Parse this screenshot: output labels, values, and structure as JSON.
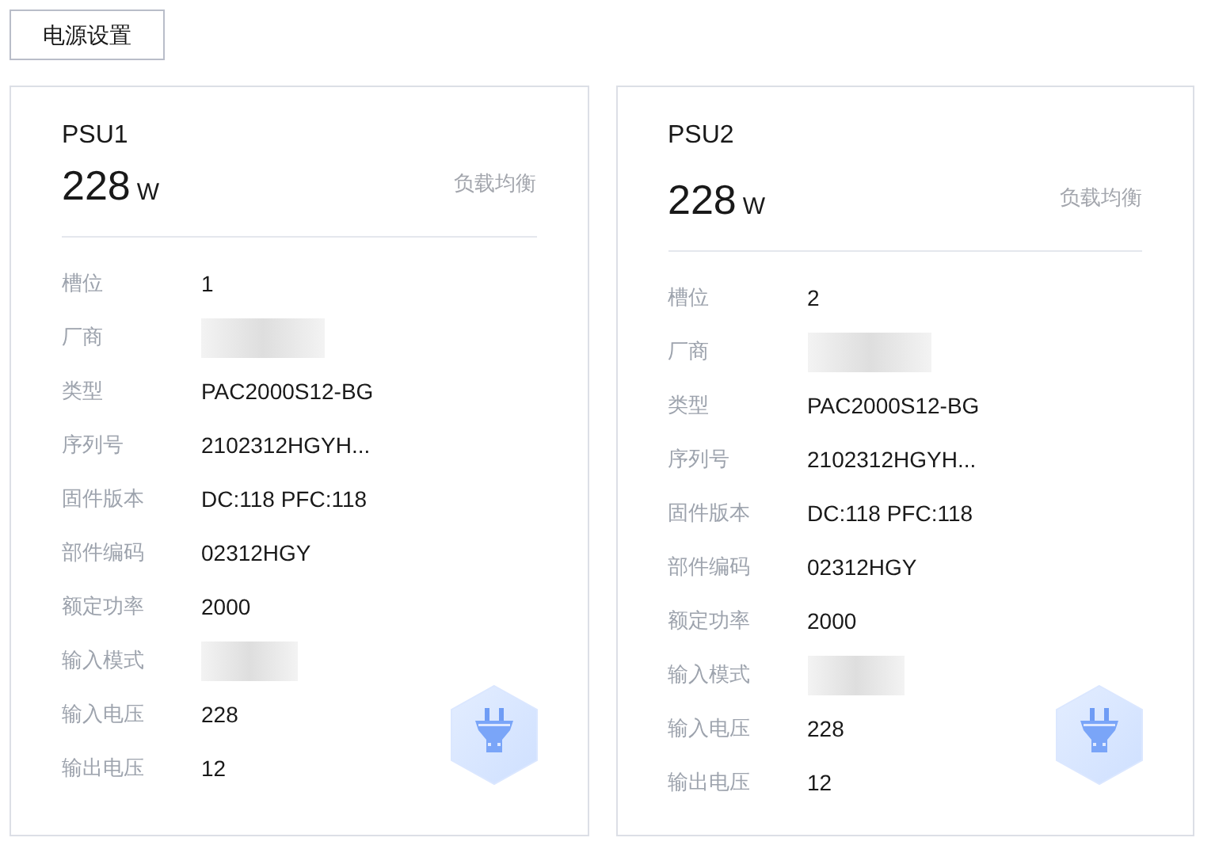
{
  "settings_button": "电源设置",
  "psus": [
    {
      "name": "PSU1",
      "power": "228",
      "unit": "W",
      "mode": "负载均衡",
      "rows": [
        {
          "label": "槽位",
          "kind": "text",
          "value": "1"
        },
        {
          "label": "厂商",
          "kind": "redacted"
        },
        {
          "label": "类型",
          "kind": "text",
          "value": "PAC2000S12-BG"
        },
        {
          "label": "序列号",
          "kind": "text",
          "value": "2102312HGYH..."
        },
        {
          "label": "固件版本",
          "kind": "text",
          "value": "DC:118 PFC:118"
        },
        {
          "label": "部件编码",
          "kind": "text",
          "value": "02312HGY"
        },
        {
          "label": "额定功率",
          "kind": "text",
          "value": "2000"
        },
        {
          "label": "输入模式",
          "kind": "redacted"
        },
        {
          "label": "输入电压",
          "kind": "text",
          "value": "228"
        },
        {
          "label": "输出电压",
          "kind": "text",
          "value": "12"
        }
      ]
    },
    {
      "name": "PSU2",
      "power": "228",
      "unit": "W",
      "mode": "负载均衡",
      "rows": [
        {
          "label": "槽位",
          "kind": "text",
          "value": "2"
        },
        {
          "label": "厂商",
          "kind": "redacted"
        },
        {
          "label": "类型",
          "kind": "text",
          "value": "PAC2000S12-BG"
        },
        {
          "label": "序列号",
          "kind": "text",
          "value": "2102312HGYH..."
        },
        {
          "label": "固件版本",
          "kind": "text",
          "value": "DC:118 PFC:118"
        },
        {
          "label": "部件编码",
          "kind": "text",
          "value": "02312HGY"
        },
        {
          "label": "额定功率",
          "kind": "text",
          "value": "2000"
        },
        {
          "label": "输入模式",
          "kind": "redacted"
        },
        {
          "label": "输入电压",
          "kind": "text",
          "value": "228"
        },
        {
          "label": "输出电压",
          "kind": "text",
          "value": "12"
        }
      ]
    }
  ]
}
